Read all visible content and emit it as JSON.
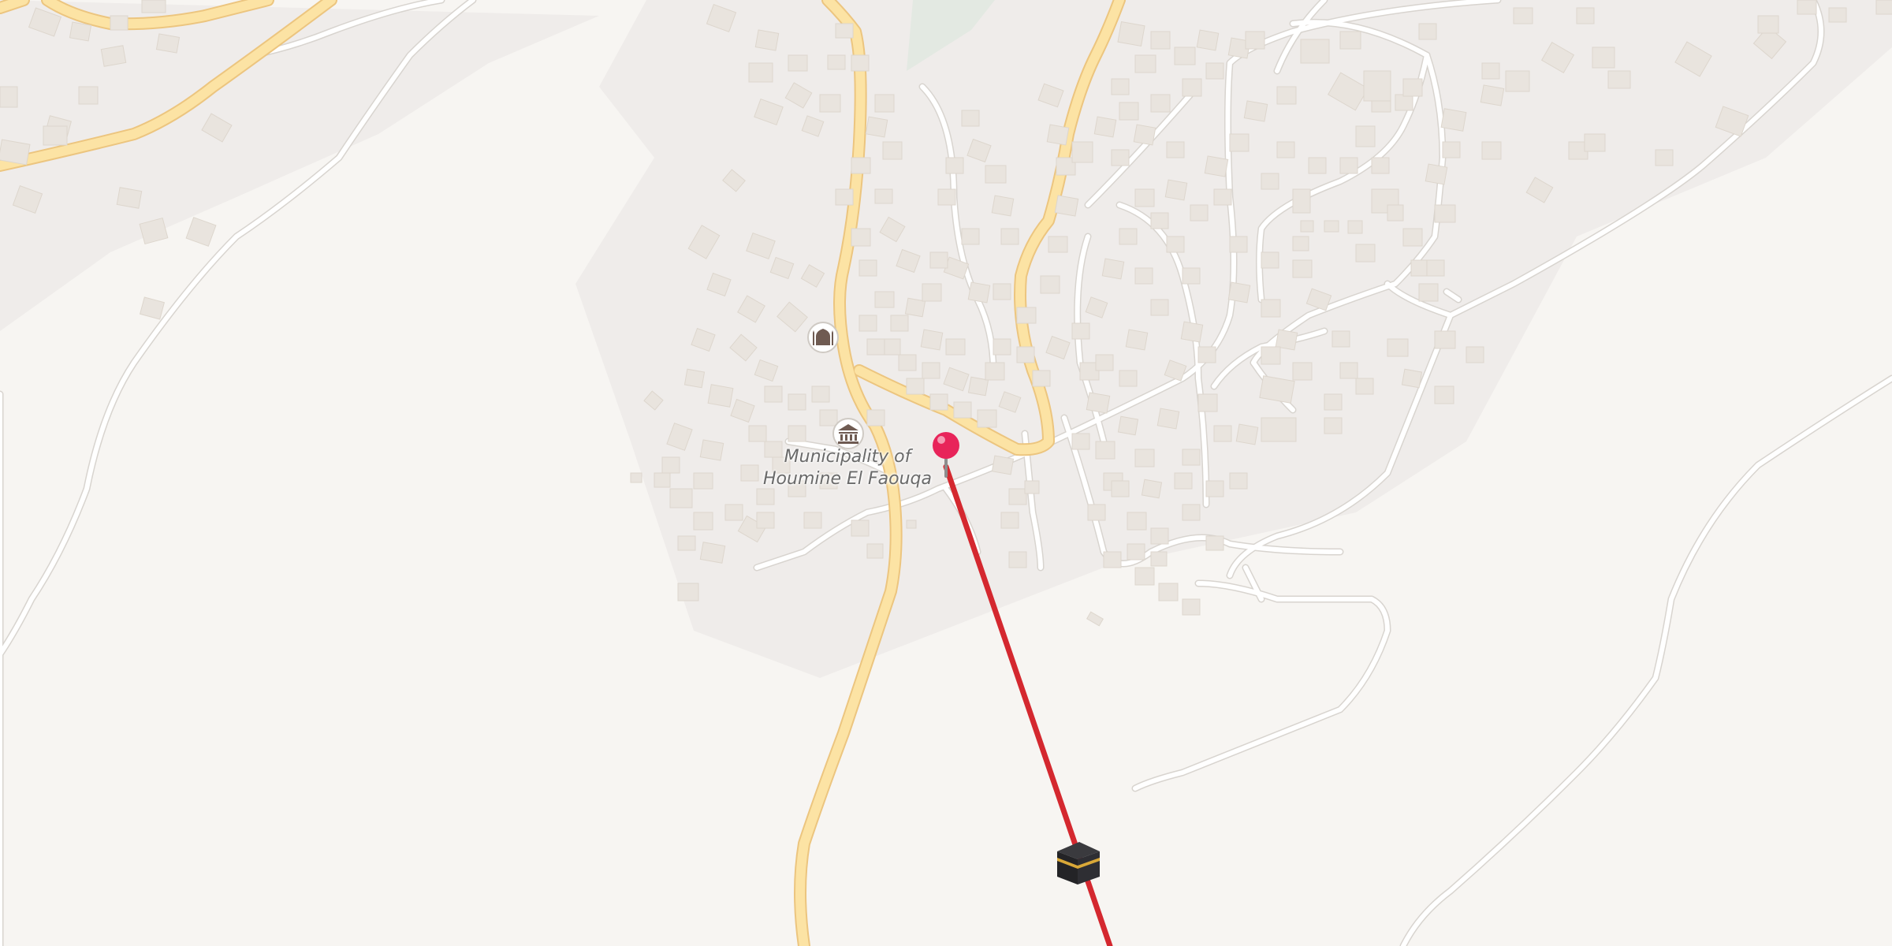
{
  "map": {
    "colors": {
      "background": "#f7f5f2",
      "settlement": "#efecea",
      "park": "#e3e9e2",
      "building": "#e9e4de",
      "building_stroke": "#ddd6cd",
      "minor_road": "#ffffff",
      "road_casing": "#d8d4cf",
      "primary_road": "#fce3a4",
      "primary_casing": "#ecc57f",
      "qibla_line": "#d4282f",
      "pin": "#e8245a",
      "kaaba": "#232326",
      "kaaba_band": "#d9a838"
    },
    "places": [
      {
        "id": "municipality",
        "label_line1": "Municipality of",
        "label_line2": "Houmine El Faouqa",
        "icon": "town-hall-icon"
      },
      {
        "id": "mosque",
        "icon": "mosque-icon"
      }
    ],
    "markers": {
      "location_pin": "location-pin-icon",
      "qibla_direction": "kaaba-icon"
    }
  }
}
